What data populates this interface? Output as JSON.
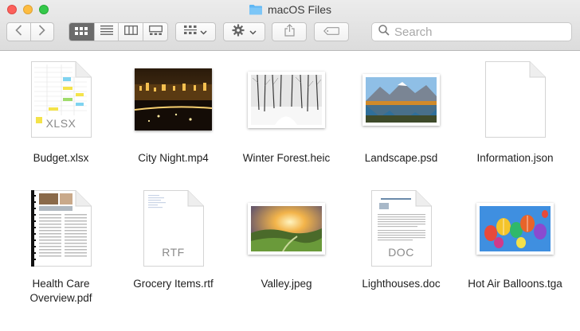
{
  "window": {
    "title": "macOS Files"
  },
  "toolbar": {
    "search_placeholder": "Search"
  },
  "files": [
    {
      "name": "Budget.xlsx",
      "ext": "XLSX",
      "kind": "spreadsheet"
    },
    {
      "name": "City Night.mp4",
      "kind": "video"
    },
    {
      "name": "Winter Forest.heic",
      "kind": "photo"
    },
    {
      "name": "Landscape.psd",
      "kind": "photo"
    },
    {
      "name": "Information.json",
      "kind": "blank-document"
    },
    {
      "name": "Health Care Overview.pdf",
      "kind": "pdf"
    },
    {
      "name": "Grocery Items.rtf",
      "ext": "RTF",
      "kind": "document"
    },
    {
      "name": "Valley.jpeg",
      "kind": "photo"
    },
    {
      "name": "Lighthouses.doc",
      "ext": "DOC",
      "kind": "document"
    },
    {
      "name": "Hot Air Balloons.tga",
      "kind": "photo"
    }
  ],
  "colors": {
    "close": "#fc605b",
    "minimize": "#fdbc40",
    "maximize": "#34c84a",
    "folder": "#5fb7f4"
  }
}
